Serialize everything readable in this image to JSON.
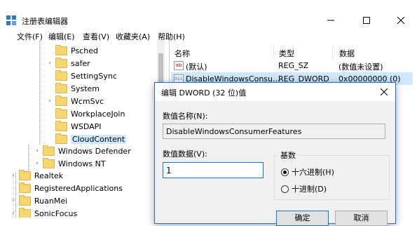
{
  "window": {
    "title": "注册表编辑器"
  },
  "menu": [
    "文件(F)",
    "编辑(E)",
    "查看(V)",
    "收藏夹(A)",
    "帮助(H)"
  ],
  "tree": [
    {
      "label": "Psched",
      "expander": "",
      "selected": false
    },
    {
      "label": "safer",
      "expander": "›",
      "selected": false
    },
    {
      "label": "SettingSync",
      "expander": "",
      "selected": false
    },
    {
      "label": "System",
      "expander": "",
      "selected": false
    },
    {
      "label": "WcmSvc",
      "expander": "›",
      "selected": false
    },
    {
      "label": "WorkplaceJoin",
      "expander": "",
      "selected": false
    },
    {
      "label": "WSDAPI",
      "expander": "",
      "selected": false
    },
    {
      "label": "CloudContent",
      "expander": "",
      "selected": true
    },
    {
      "label": "Windows Defender",
      "expander": "›",
      "selected": false
    },
    {
      "label": "Windows NT",
      "expander": "›",
      "selected": false
    },
    {
      "label": "Realtek",
      "expander": "›",
      "selected": false
    },
    {
      "label": "RegisteredApplications",
      "expander": "",
      "selected": false
    },
    {
      "label": "RuanMei",
      "expander": "›",
      "selected": false
    },
    {
      "label": "SonicFocus",
      "expander": "›",
      "selected": false
    }
  ],
  "list": {
    "headers": {
      "name": "名称",
      "type": "类型",
      "data": "数据"
    },
    "rows": [
      {
        "icon": "ab",
        "name": "(默认)",
        "type": "REG_SZ",
        "data": "(数值未设置)"
      },
      {
        "icon": "011",
        "name": "DisableWindowsConsu...",
        "type": "REG_DWORD",
        "data": "0x00000000 (0)"
      }
    ]
  },
  "dialog": {
    "title": "编辑 DWORD (32 位)值",
    "value_name_label": "数值名称(N):",
    "value_name": "DisableWindowsConsumerFeatures",
    "value_data_label": "数值数据(V):",
    "value_data": "1",
    "base_label": "基数",
    "hex_label": "十六进制(H)",
    "dec_label": "十进制(D)",
    "selected_base": "hex",
    "ok": "确定",
    "cancel": "取消"
  }
}
